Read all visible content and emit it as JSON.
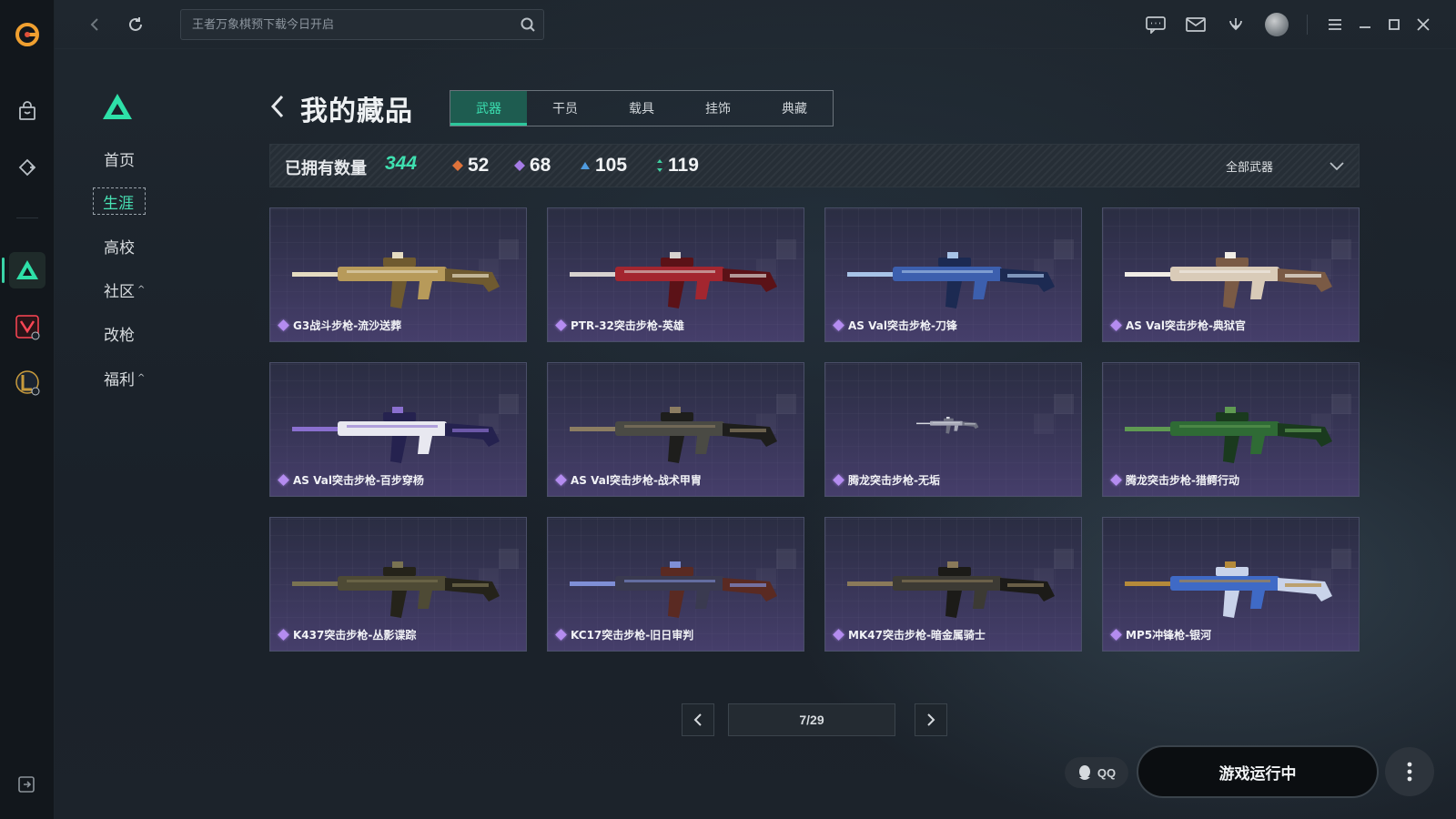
{
  "topbar": {
    "search_placeholder": "王者万象棋预下载今日开启"
  },
  "sidebar_menu": {
    "items": [
      {
        "label": "首页"
      },
      {
        "label": "生涯"
      },
      {
        "label": "高校"
      },
      {
        "label": "社区",
        "caret": "^"
      },
      {
        "label": "改枪"
      },
      {
        "label": "福利",
        "caret": "^"
      }
    ]
  },
  "header": {
    "title": "我的藏品",
    "tabs": [
      {
        "label": "武器"
      },
      {
        "label": "干员"
      },
      {
        "label": "载具"
      },
      {
        "label": "挂饰"
      },
      {
        "label": "典藏"
      }
    ]
  },
  "stats": {
    "label": "已拥有数量",
    "total": "344",
    "grades": [
      {
        "value": "52",
        "color": "#e0733a"
      },
      {
        "value": "68",
        "color": "#a57be6"
      },
      {
        "value": "105",
        "color": "#4f9be0"
      },
      {
        "value": "119",
        "color": "#3fd0a0"
      }
    ],
    "filter_label": "全部武器"
  },
  "items": [
    {
      "name": "G3战斗步枪-流沙送葬",
      "palette": [
        "#b79a5a",
        "#6f5a30",
        "#e5dcc2"
      ]
    },
    {
      "name": "PTR-32突击步枪-英雄",
      "palette": [
        "#a3262f",
        "#5b1217",
        "#d8d3d0"
      ]
    },
    {
      "name": "AS Val突击步枪-刀锋",
      "palette": [
        "#3c5fae",
        "#1c2a52",
        "#a8c4e8"
      ]
    },
    {
      "name": "AS Val突击步枪-典狱官",
      "palette": [
        "#d9cbb8",
        "#7a5a45",
        "#f1ede6"
      ]
    },
    {
      "name": "AS Val突击步枪-百步穿杨",
      "palette": [
        "#e8e8f0",
        "#25224f",
        "#8a6fcf"
      ]
    },
    {
      "name": "AS Val突击步枪-战术甲胄",
      "palette": [
        "#4a4a44",
        "#1e1e1c",
        "#8c7d62"
      ]
    },
    {
      "name": "腾龙突击步枪-无垢",
      "palette": [
        "#a8aab8",
        "#6e7080",
        "#d6d8e0"
      ]
    },
    {
      "name": "腾龙突击步枪-猎鳄行动",
      "palette": [
        "#2f6b35",
        "#1a3a1e",
        "#5f9a52"
      ]
    },
    {
      "name": "K437突击步枪-丛影谍踪",
      "palette": [
        "#4e4a35",
        "#25231a",
        "#7a7352"
      ]
    },
    {
      "name": "KC17突击步枪-旧日审判",
      "palette": [
        "#3a3a50",
        "#5a2a22",
        "#7f8fd6"
      ]
    },
    {
      "name": "MK47突击步枪-暗金属骑士",
      "palette": [
        "#3c3a34",
        "#1c1b18",
        "#8a7a5a"
      ]
    },
    {
      "name": "MP5冲锋枪-银河",
      "palette": [
        "#3f6ac6",
        "#c9d3ea",
        "#b58a3a"
      ]
    }
  ],
  "pagination": {
    "text": "7/29"
  },
  "bottom": {
    "qq_label": "QQ",
    "launch_label": "游戏运行中"
  }
}
